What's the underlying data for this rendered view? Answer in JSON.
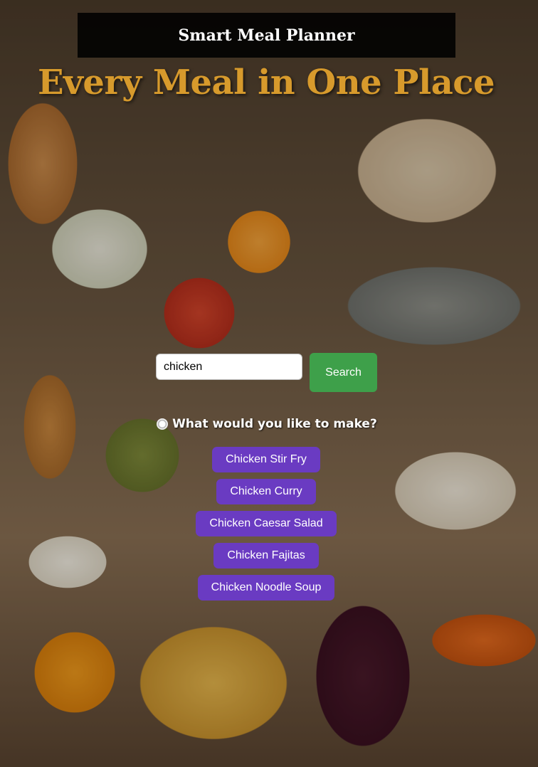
{
  "header": {
    "title": "Smart Meal Planner"
  },
  "hero": {
    "tagline": "Every Meal in One Place"
  },
  "search": {
    "value": "chicken",
    "button_label": "Search"
  },
  "prompt": {
    "text": "What would you like to make?"
  },
  "results": [
    {
      "label": "Chicken Stir Fry"
    },
    {
      "label": "Chicken Curry"
    },
    {
      "label": "Chicken Caesar Salad"
    },
    {
      "label": "Chicken Fajitas"
    },
    {
      "label": "Chicken Noodle Soup"
    }
  ],
  "colors": {
    "hero_gold": "#d79a2c",
    "search_green": "#3ea04a",
    "result_purple": "#6a3bc2"
  }
}
